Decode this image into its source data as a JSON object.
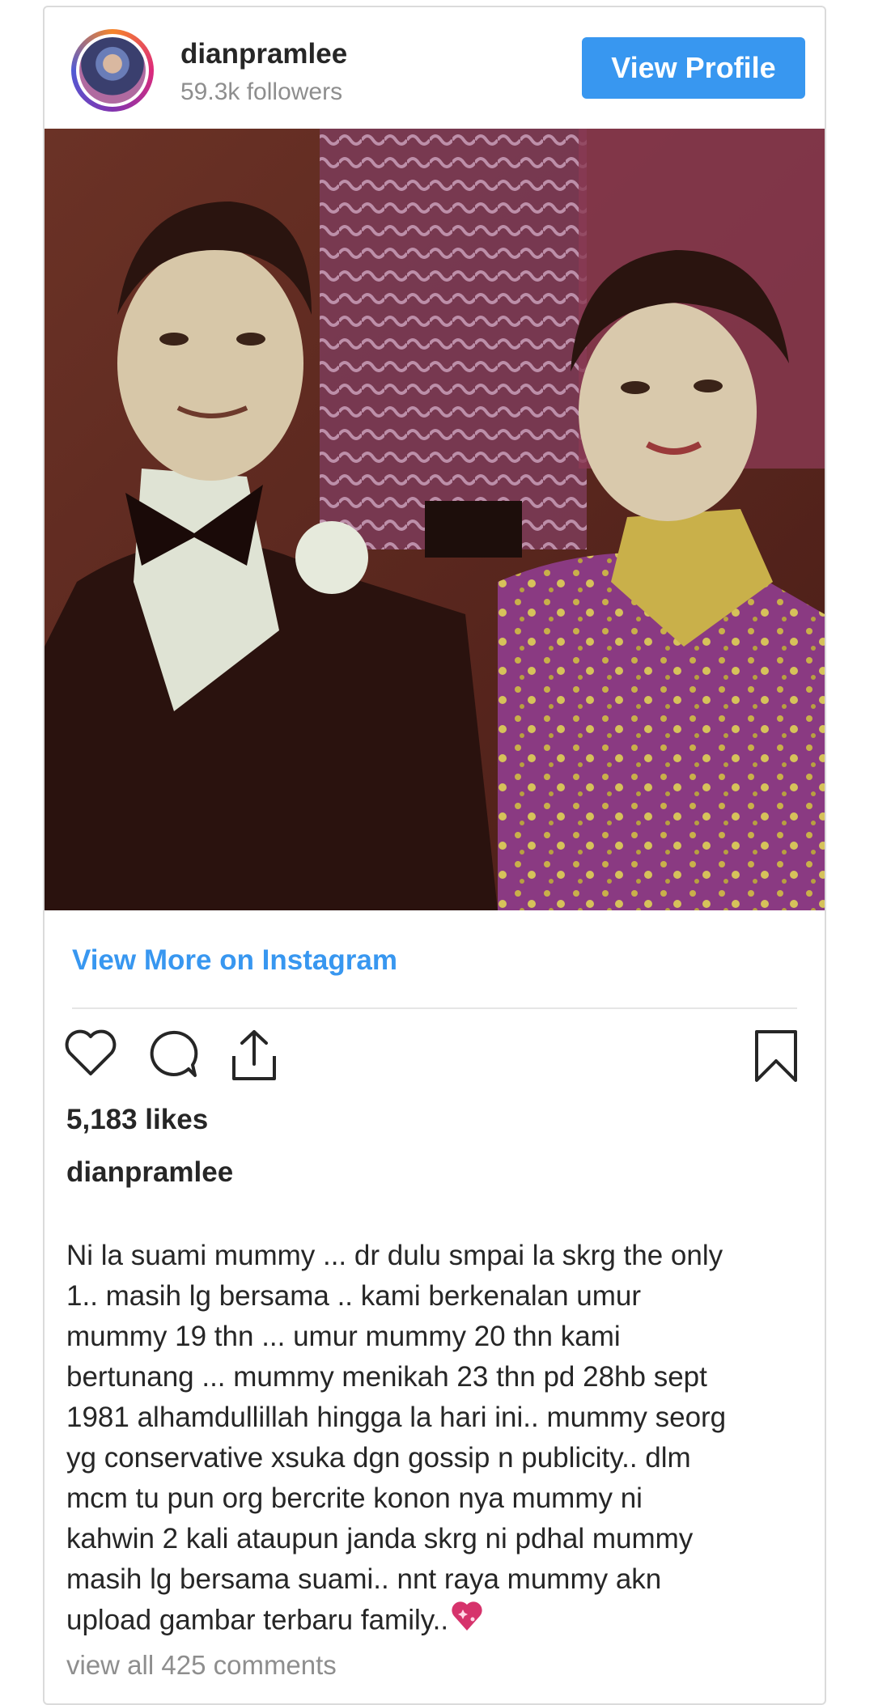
{
  "header": {
    "username": "dianpramlee",
    "followers": "59.3k followers",
    "view_profile_label": "View Profile"
  },
  "post": {
    "image_alt": "Vintage photo of a couple",
    "view_more_label": "View More on Instagram",
    "likes": "5,183 likes",
    "caption_username": "dianpramlee",
    "caption_lines": [
      "Ni la suami mummy ... dr dulu smpai la skrg the only",
      "1.. masih lg bersama .. kami berkenalan umur",
      "mummy 19 thn ... umur mummy 20 thn kami",
      "bertunang ... mummy menikah 23 thn pd 28hb sept",
      "1981 alhamdullillah hingga la hari ini.. mummy seorg",
      "yg conservative xsuka dgn gossip n publicity.. dlm",
      "mcm tu pun org bercrite konon nya mummy ni",
      "kahwin 2 kali ataupun janda skrg ni pdhal mummy",
      "masih lg bersama suami.. nnt raya mummy akn",
      "upload gambar terbaru family.."
    ],
    "view_comments": "view all 425 comments"
  },
  "icons": {
    "like": "heart-icon",
    "comment": "comment-icon",
    "share": "share-icon",
    "save": "bookmark-icon",
    "caption_emoji": "sparkling-heart-icon"
  },
  "colors": {
    "accent": "#3897f0",
    "text": "#262626",
    "muted": "#8e8e8e"
  }
}
